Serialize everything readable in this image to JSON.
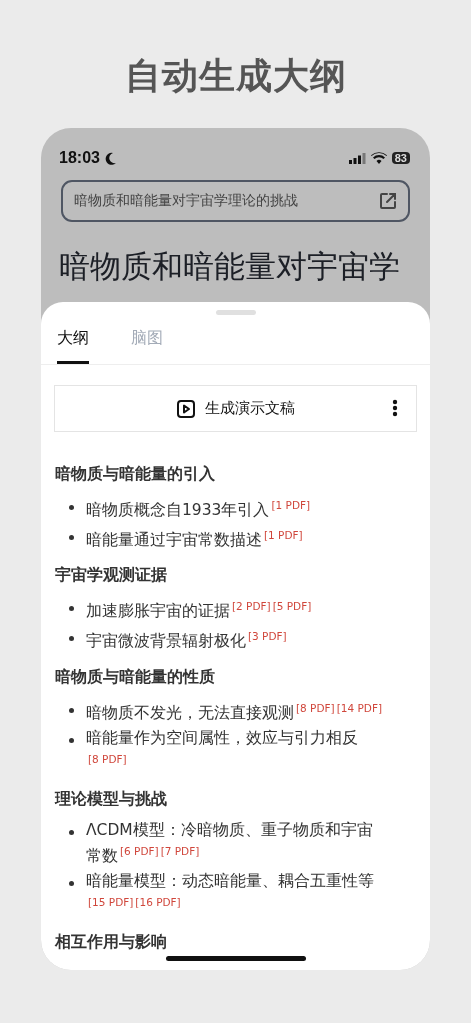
{
  "headline": "自动生成大纲",
  "status_bar": {
    "time": "18:03",
    "battery": "83"
  },
  "query_field": {
    "value": "暗物质和暗能量对宇宙学理论的挑战"
  },
  "page_title": "暗物质和暗能量对宇宙学",
  "tabs": [
    {
      "label": "大纲",
      "selected": true
    },
    {
      "label": "脑图",
      "selected": false
    }
  ],
  "action_button": {
    "label": "生成演示文稿"
  },
  "sections": [
    {
      "heading": "暗物质与暗能量的引入",
      "items": [
        {
          "text": "暗物质概念自1933年引入",
          "refs": [
            "[1 PDF]"
          ]
        },
        {
          "text": "暗能量通过宇宙常数描述",
          "refs": [
            "[1 PDF]"
          ]
        }
      ]
    },
    {
      "heading": "宇宙学观测证据",
      "items": [
        {
          "text": "加速膨胀宇宙的证据",
          "refs": [
            "[2 PDF]",
            "[5 PDF]"
          ]
        },
        {
          "text": "宇宙微波背景辐射极化",
          "refs": [
            "[3 PDF]"
          ]
        }
      ]
    },
    {
      "heading": "暗物质与暗能量的性质",
      "items": [
        {
          "text": "暗物质不发光，无法直接观测",
          "refs": [
            "[8 PDF]",
            "[14 PDF]"
          ]
        },
        {
          "text": "暗能量作为空间属性，效应与引力相反",
          "refs": [
            "[8 PDF]"
          ]
        }
      ]
    },
    {
      "heading": "理论模型与挑战",
      "items": [
        {
          "text": "ΛCDM模型：冷暗物质、重子物质和宇宙常数",
          "refs": [
            "[6 PDF]",
            "[7 PDF]"
          ]
        },
        {
          "text": "暗能量模型：动态暗能量、耦合五重性等",
          "refs": [
            "[15 PDF]",
            "[16 PDF]"
          ]
        }
      ]
    },
    {
      "heading": "相互作用与影响"
    }
  ]
}
